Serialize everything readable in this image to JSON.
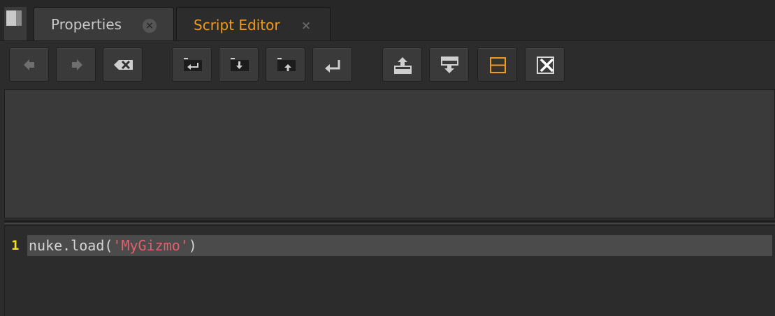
{
  "tabs": [
    {
      "label": "Properties",
      "close_label": "×",
      "active": false
    },
    {
      "label": "Script Editor",
      "close_label": "×",
      "active": true
    }
  ],
  "toolbar": {
    "buttons": [
      {
        "icon": "previous-script-icon",
        "name": "previous-script-button"
      },
      {
        "icon": "next-script-icon",
        "name": "next-script-button"
      },
      {
        "icon": "clear-history-icon",
        "name": "clear-history-button"
      },
      {
        "icon": "source-script-icon",
        "name": "source-script-button"
      },
      {
        "icon": "load-script-icon",
        "name": "load-script-button"
      },
      {
        "icon": "save-script-icon",
        "name": "save-script-button"
      },
      {
        "icon": "run-script-icon",
        "name": "run-script-button"
      },
      {
        "icon": "show-input-only-icon",
        "name": "show-input-only-button"
      },
      {
        "icon": "show-output-only-icon",
        "name": "show-output-only-button"
      },
      {
        "icon": "show-both-icon",
        "name": "show-both-button",
        "active": true
      },
      {
        "icon": "clear-output-icon",
        "name": "clear-output-button"
      }
    ]
  },
  "editor": {
    "line_number": "1",
    "code_prefix": "nuke.load(",
    "code_string": "'MyGizmo'",
    "code_suffix": ")"
  },
  "colors": {
    "active_tab_text": "#f29a1c",
    "line_number": "#f4e21b",
    "string_literal": "#e25f6d",
    "background": "#2c2c2c"
  }
}
